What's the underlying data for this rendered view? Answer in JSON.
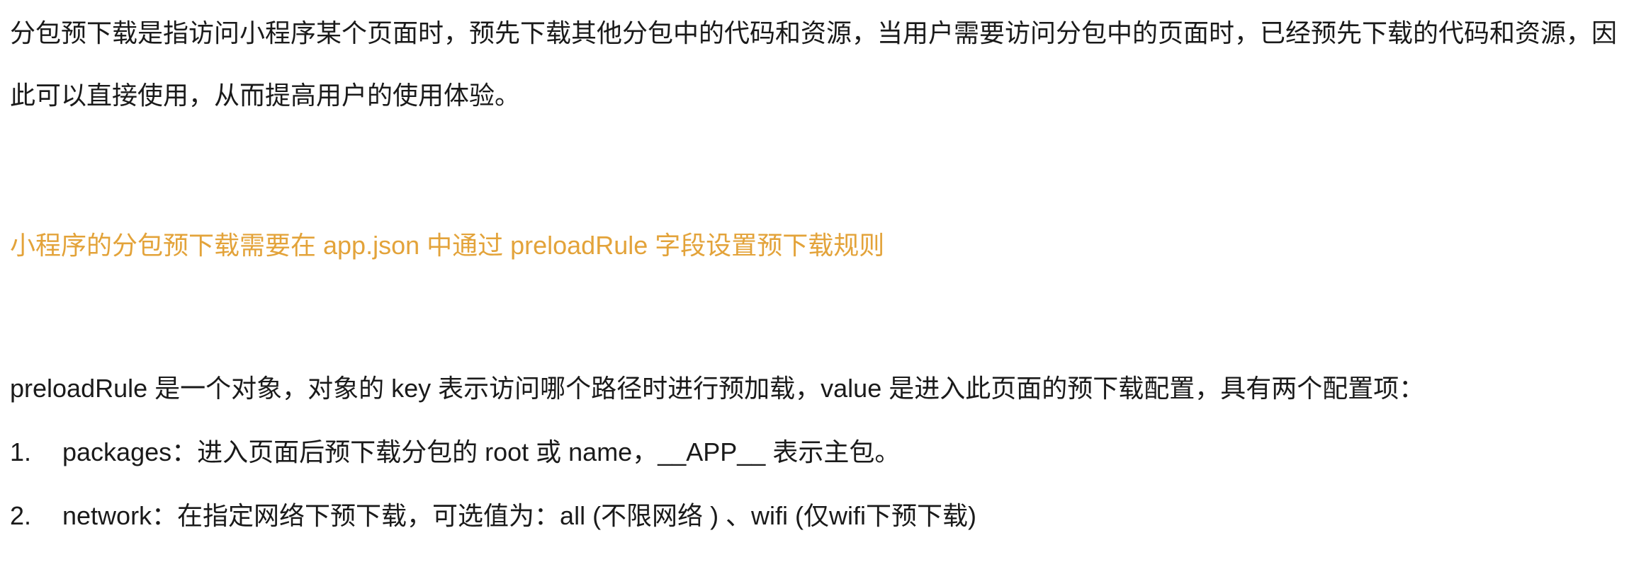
{
  "intro": {
    "text": "分包预下载是指访问小程序某个页面时，预先下载其他分包中的代码和资源，当用户需要访问分包中的页面时，已经预先下载的代码和资源，因此可以直接使用，从而提高用户的使用体验。"
  },
  "heading": {
    "text": "小程序的分包预下载需要在 app.json 中通过 preloadRule 字段设置预下载规则",
    "color": "#e3a33a"
  },
  "description": {
    "text": "preloadRule 是一个对象，对象的 key 表示访问哪个路径时进行预加载，value 是进入此页面的预下载配置，具有两个配置项："
  },
  "list": [
    {
      "number": "1.",
      "text": "packages：进入页面后预下载分包的 root 或 name，__APP__ 表示主包。"
    },
    {
      "number": "2.",
      "text": "network：在指定网络下预下载，可选值为：all (不限网络 ) 、wifi (仅wifi下预下载)"
    }
  ]
}
